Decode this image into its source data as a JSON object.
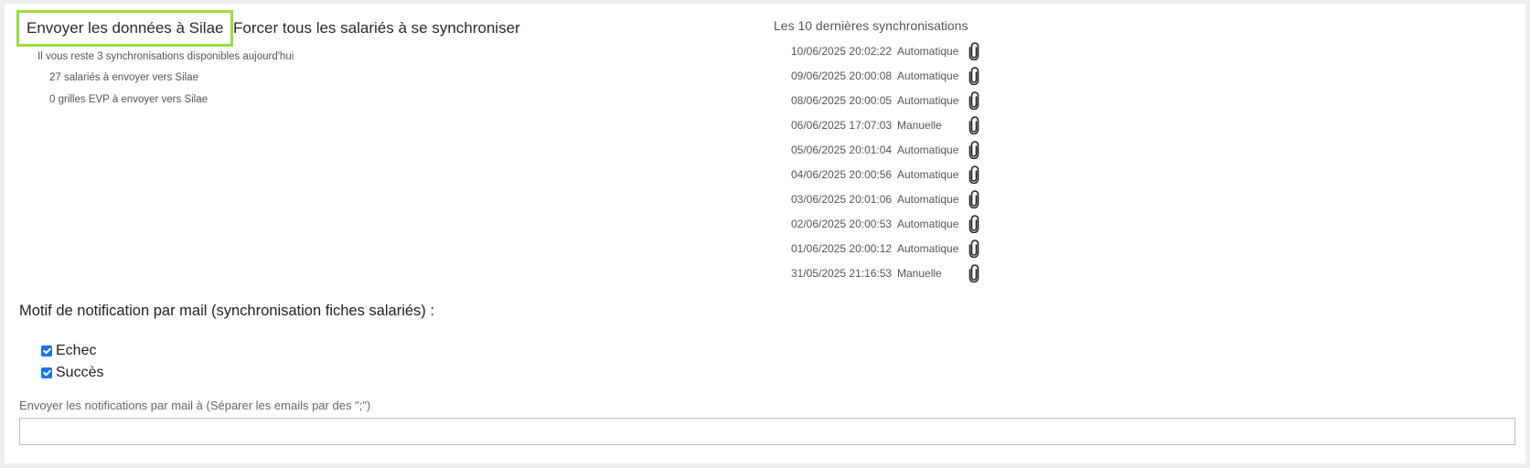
{
  "actions": {
    "send_label": "Envoyer les données à Silae",
    "force_sync_label": "Forcer tous les salariés à se synchroniser"
  },
  "info": {
    "remaining": "Il vous reste 3 synchronisations disponibles aujourd'hui",
    "employees": "27 salariés à envoyer vers Silae",
    "evp": "0 grilles EVP à envoyer vers Silae"
  },
  "sync_history": {
    "title": "Les 10 dernières synchronisations",
    "items": [
      {
        "date": "10/06/2025 20:02:22",
        "type": "Automatique"
      },
      {
        "date": "09/06/2025 20:00:08",
        "type": "Automatique"
      },
      {
        "date": "08/06/2025 20:00:05",
        "type": "Automatique"
      },
      {
        "date": "06/06/2025 17:07:03",
        "type": "Manuelle"
      },
      {
        "date": "05/06/2025 20:01:04",
        "type": "Automatique"
      },
      {
        "date": "04/06/2025 20:00:56",
        "type": "Automatique"
      },
      {
        "date": "03/06/2025 20:01:06",
        "type": "Automatique"
      },
      {
        "date": "02/06/2025 20:00:53",
        "type": "Automatique"
      },
      {
        "date": "01/06/2025 20:00:12",
        "type": "Automatique"
      },
      {
        "date": "31/05/2025 21:16:53",
        "type": "Manuelle"
      }
    ],
    "icon": "paperclip-icon"
  },
  "notifications": {
    "title": "Motif de notification par mail (synchronisation fiches salariés) :",
    "options": [
      {
        "label": "Echec",
        "checked": true
      },
      {
        "label": "Succès",
        "checked": true
      }
    ],
    "email_label": "Envoyer les notifications par mail à (Séparer les emails par des \";\")",
    "email_value": ""
  },
  "colors": {
    "highlight_border": "#9bdd3a",
    "checkbox": "#1a73e8"
  }
}
